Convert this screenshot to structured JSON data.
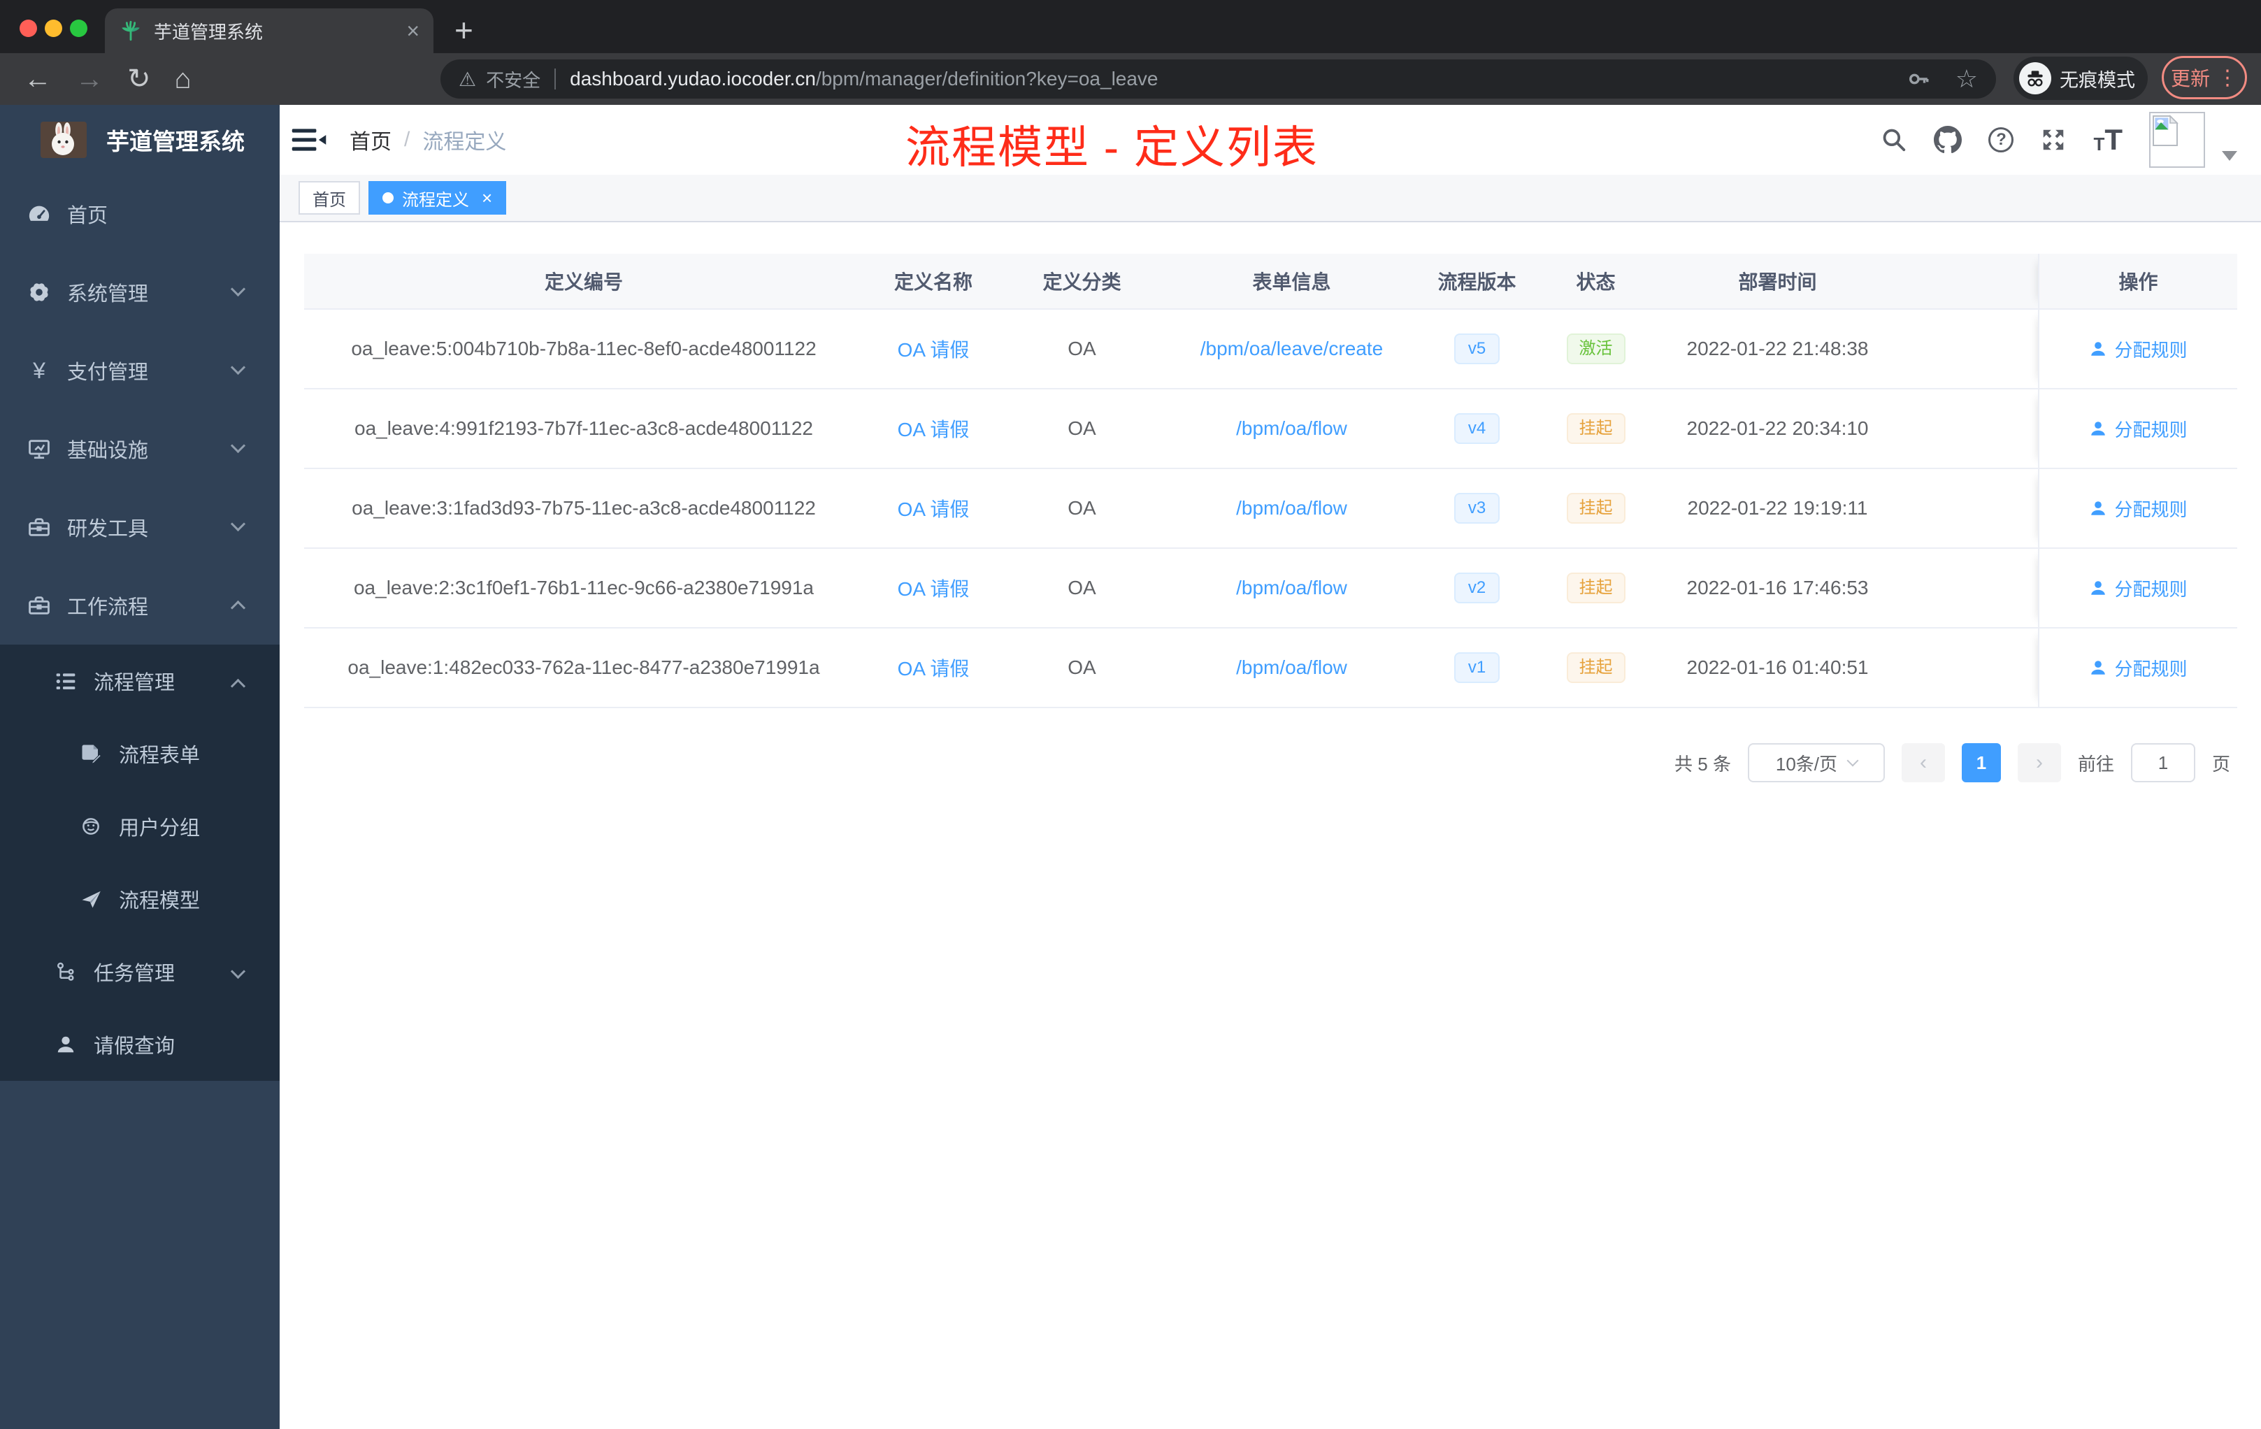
{
  "colors": {
    "accent": "#409eff",
    "annotation_red": "#fe2c19",
    "status_active": "#67c23a",
    "status_suspended": "#e6a23c",
    "sidebar_bg": "#304156",
    "submenu_bg": "#1f2d3d"
  },
  "icons": {
    "back": "←",
    "forward": "→",
    "reload": "↻",
    "home": "⌂",
    "warn": "⚠",
    "star": "☆",
    "dots": "⋮",
    "plus": "+",
    "tab_close": "×",
    "tag_close": "×",
    "question": "?",
    "prev": "‹",
    "next": "›",
    "font_small": "T",
    "font_big": "T",
    "yen": "¥"
  },
  "browser": {
    "tab_title": "芋道管理系统",
    "security_label": "不安全",
    "url_host": "dashboard.yudao.iocoder.cn",
    "url_path": "/bpm/manager/definition?key=oa_leave",
    "incognito_label": "无痕模式",
    "update_label": "更新"
  },
  "sidebar": {
    "title": "芋道管理系统",
    "items": [
      {
        "label": "首页"
      },
      {
        "label": "系统管理"
      },
      {
        "label": "支付管理"
      },
      {
        "label": "基础设施"
      },
      {
        "label": "研发工具"
      },
      {
        "label": "工作流程"
      }
    ],
    "sub": [
      {
        "label": "流程管理"
      },
      {
        "label": "流程表单"
      },
      {
        "label": "用户分组"
      },
      {
        "label": "流程模型"
      },
      {
        "label": "任务管理"
      },
      {
        "label": "请假查询"
      }
    ]
  },
  "navbar": {
    "breadcrumb_home": "首页",
    "breadcrumb_sep": "/",
    "breadcrumb_current": "流程定义",
    "annotation": "流程模型 - 定义列表"
  },
  "tags": {
    "home": "首页",
    "active": "流程定义"
  },
  "table": {
    "columns": [
      "定义编号",
      "定义名称",
      "定义分类",
      "表单信息",
      "流程版本",
      "状态",
      "部署时间",
      "操作"
    ],
    "rows": [
      {
        "id": "oa_leave:5:004b710b-7b8a-11ec-8ef0-acde48001122",
        "name": "OA 请假",
        "category": "OA",
        "form": "/bpm/oa/leave/create",
        "version": "v5",
        "status": "激活",
        "time": "2022-01-22 21:48:38",
        "action": "分配规则"
      },
      {
        "id": "oa_leave:4:991f2193-7b7f-11ec-a3c8-acde48001122",
        "name": "OA 请假",
        "category": "OA",
        "form": "/bpm/oa/flow",
        "version": "v4",
        "status": "挂起",
        "time": "2022-01-22 20:34:10",
        "action": "分配规则"
      },
      {
        "id": "oa_leave:3:1fad3d93-7b75-11ec-a3c8-acde48001122",
        "name": "OA 请假",
        "category": "OA",
        "form": "/bpm/oa/flow",
        "version": "v3",
        "status": "挂起",
        "time": "2022-01-22 19:19:11",
        "action": "分配规则"
      },
      {
        "id": "oa_leave:2:3c1f0ef1-76b1-11ec-9c66-a2380e71991a",
        "name": "OA 请假",
        "category": "OA",
        "form": "/bpm/oa/flow",
        "version": "v2",
        "status": "挂起",
        "time": "2022-01-16 17:46:53",
        "action": "分配规则"
      },
      {
        "id": "oa_leave:1:482ec033-762a-11ec-8477-a2380e71991a",
        "name": "OA 请假",
        "category": "OA",
        "form": "/bpm/oa/flow",
        "version": "v1",
        "status": "挂起",
        "time": "2022-01-16 01:40:51",
        "action": "分配规则"
      }
    ]
  },
  "pagination": {
    "total": "共 5 条",
    "page_size": "10条/页",
    "current_page": "1",
    "goto_label": "前往",
    "goto_value": "1",
    "page_unit": "页"
  }
}
